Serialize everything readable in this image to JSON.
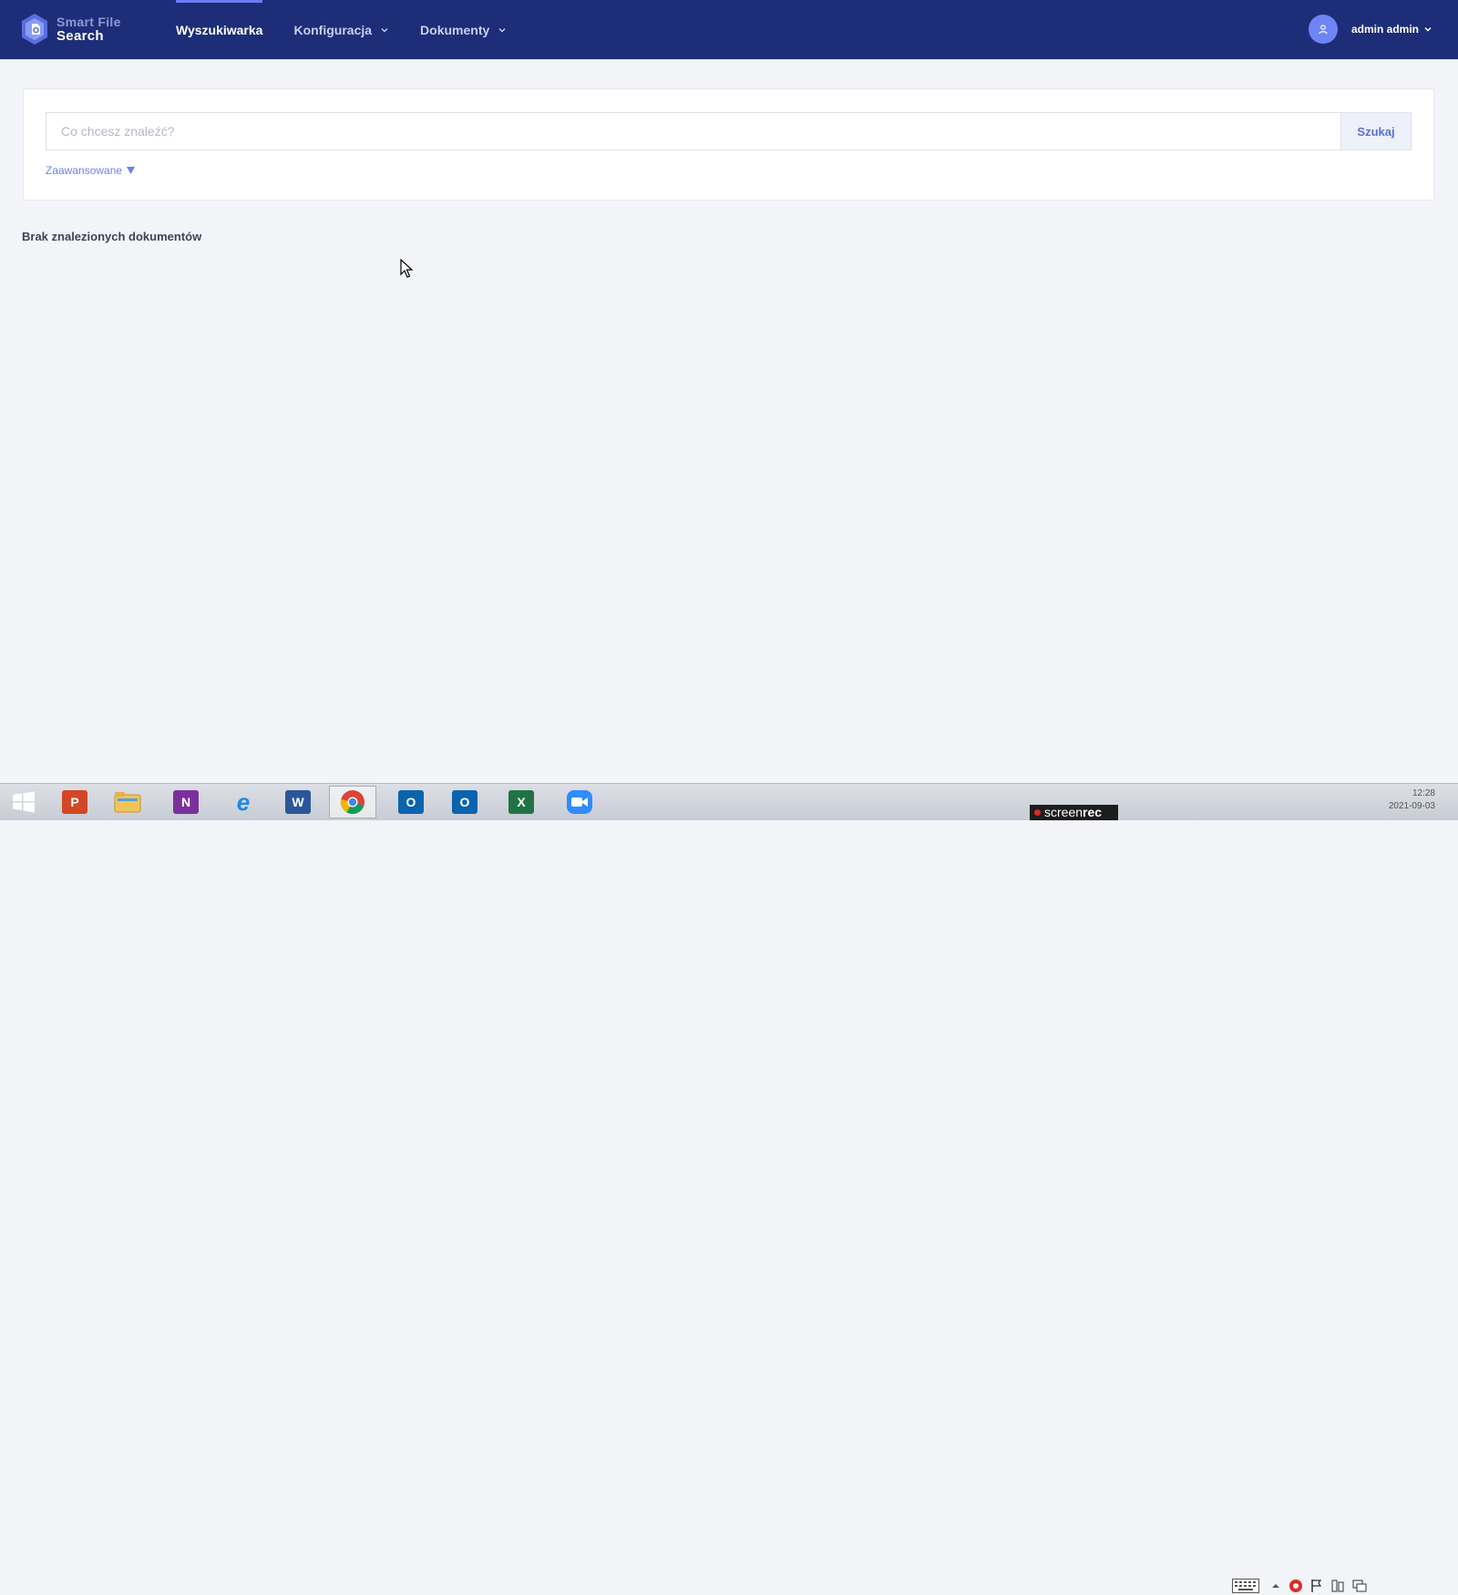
{
  "brand": {
    "line1": "Smart File",
    "line2": "Search"
  },
  "nav": {
    "items": [
      {
        "label": "Wyszukiwarka",
        "active": true
      },
      {
        "label": "Konfiguracja",
        "dropdown": true
      },
      {
        "label": "Dokumenty",
        "dropdown": true
      }
    ]
  },
  "user": {
    "name": "admin admin"
  },
  "search": {
    "placeholder": "Co chcesz znaleźć?",
    "button_label": "Szukaj",
    "advanced_label": "Zaawansowane"
  },
  "results": {
    "empty_message": "Brak znalezionych dokumentów"
  },
  "taskbar": {
    "apps": [
      {
        "name": "start-button",
        "icon": "windows-logo-icon"
      },
      {
        "name": "powerpoint",
        "letter": "P",
        "color": "#d24726"
      },
      {
        "name": "file-explorer",
        "icon": "folder-icon"
      },
      {
        "name": "onenote",
        "letter": "N",
        "color": "#7b2f9d"
      },
      {
        "name": "internet-explorer",
        "letter": "e",
        "color": "#1e88e5"
      },
      {
        "name": "word",
        "letter": "W",
        "color": "#2b579a"
      },
      {
        "name": "chrome",
        "icon": "chrome-icon",
        "active": true
      },
      {
        "name": "outlook",
        "letter": "O",
        "color": "#0a64ad"
      },
      {
        "name": "outlook-2",
        "letter": "O",
        "color": "#0a64ad"
      },
      {
        "name": "excel",
        "letter": "X",
        "color": "#217346"
      },
      {
        "name": "zoom",
        "icon": "video-camera-icon",
        "color": "#2d8cff"
      }
    ],
    "recorder": {
      "prefix": "screen",
      "suffix": "rec"
    },
    "clock": {
      "time": "12:28",
      "date": "2021-09-03"
    }
  },
  "colors": {
    "header_bg": "#1e2d78",
    "accent": "#6f84f4",
    "page_bg": "#f3f4f7"
  }
}
